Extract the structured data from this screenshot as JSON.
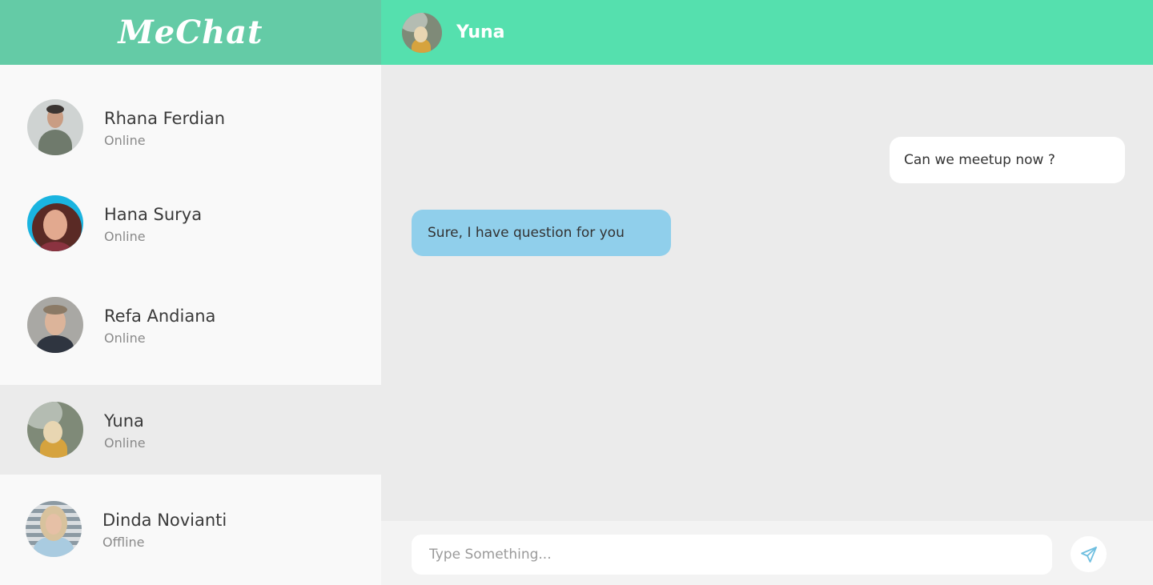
{
  "app": {
    "brand": "MeChat"
  },
  "contacts": [
    {
      "name": "Rhana Ferdian",
      "status": "Online"
    },
    {
      "name": "Hana Surya",
      "status": "Online"
    },
    {
      "name": "Refa Andiana",
      "status": "Online"
    },
    {
      "name": "Yuna",
      "status": "Online"
    },
    {
      "name": "Dinda Novianti",
      "status": "Offline"
    }
  ],
  "active_chat": {
    "name": "Yuna"
  },
  "messages": [
    {
      "direction": "outgoing",
      "text": "Can we meetup now ?"
    },
    {
      "direction": "incoming",
      "text": "Sure, I have question for you"
    }
  ],
  "composer": {
    "placeholder": "Type Something..."
  },
  "colors": {
    "brand": "#64cba6",
    "header": "#55e0ae",
    "incoming_bubble": "#90cfeb",
    "outgoing_bubble": "#ffffff",
    "send_icon": "#6fbfe0"
  },
  "icons": {
    "send": "paper-plane-icon"
  }
}
